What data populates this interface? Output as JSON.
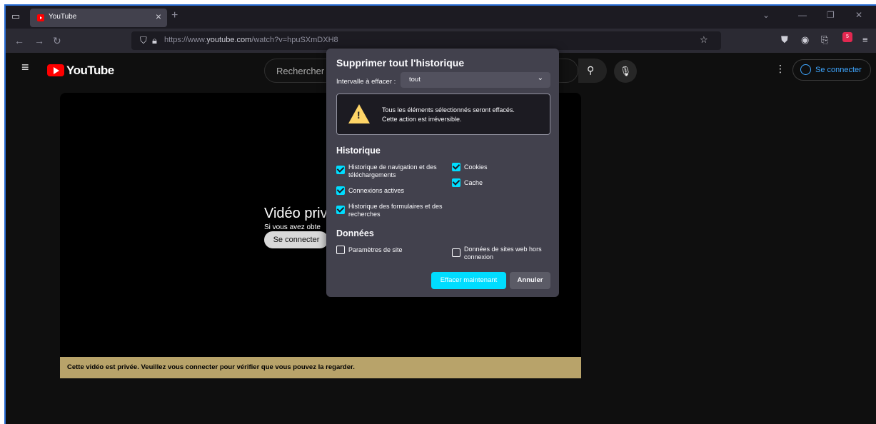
{
  "browser": {
    "tab": {
      "title": "YouTube"
    },
    "url": {
      "prefix": "https://www.",
      "domain": "youtube.com",
      "path": "/watch?v=hpuSXmDXH8"
    },
    "badge_count": "5"
  },
  "youtube": {
    "logo_text": "YouTube",
    "search_placeholder": "Rechercher",
    "signin_label": "Se connecter"
  },
  "player": {
    "title": "Vidéo privé",
    "subtitle": "Si vous avez obte",
    "signin_label": "Se connecter",
    "banner": "Cette vidéo est privée. Veuillez vous connecter pour vérifier que vous pouvez la regarder."
  },
  "dialog": {
    "title": "Supprimer tout l'historique",
    "range_label": "Intervalle à effacer :",
    "range_value": "tout",
    "warning_line1": "Tous les éléments sélectionnés seront effacés.",
    "warning_line2": "Cette action est irréversible.",
    "history_section": "Historique",
    "history_items": [
      {
        "label_line1": "Historique de navigation et des",
        "label_line2": "téléchargements",
        "checked": true
      },
      {
        "label": "Connexions actives",
        "checked": true
      },
      {
        "label_line1": "Historique des formulaires et des",
        "label_line2": "recherches",
        "checked": true
      },
      {
        "label": "Cookies",
        "checked": true
      },
      {
        "label": "Cache",
        "checked": true
      }
    ],
    "data_section": "Données",
    "data_items": [
      {
        "label": "Paramètres de site",
        "checked": false
      },
      {
        "label_line1": "Données de sites web hors",
        "label_line2": "connexion",
        "checked": false
      }
    ],
    "clear_button": "Effacer maintenant",
    "cancel_button": "Annuler"
  },
  "colors": {
    "accent": "#00ddff",
    "warning": "#ffd567",
    "youtube_red": "#ff0000",
    "banner": "#b8a36a"
  }
}
